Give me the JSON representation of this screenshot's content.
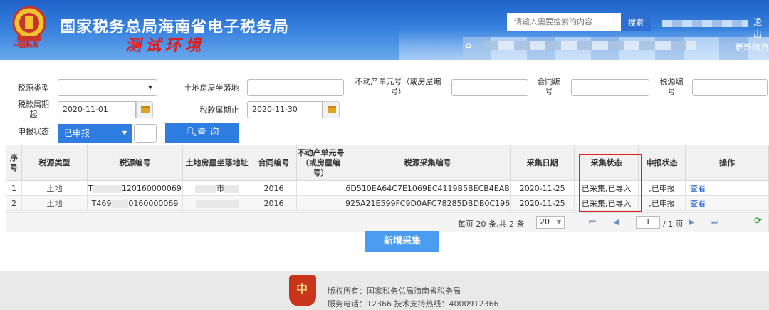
{
  "header": {
    "title": "国家税务总局海南省电子税务局",
    "subtitle": "测试环境",
    "seal_text": "中国税务",
    "search_placeholder": "请输入需要搜索的内容",
    "search_button": "搜索",
    "logout": "退出",
    "update_info": "更新信息",
    "colors": {
      "header_blue": "#1f62c9",
      "accent_red": "#e21b1b"
    }
  },
  "filters": {
    "tax_type_label": "税源类型",
    "tax_type_value": "",
    "location_label": "土地房屋坐落地",
    "location_value": "",
    "unit_no_label": "不动产单元号（或房屋编号）",
    "unit_no_value": "",
    "contract_label": "合同编号",
    "contract_value": "",
    "source_no_label": "税源编号",
    "source_no_value": "",
    "period_start_label": "税款属期起",
    "period_start_value": "2020-11-01",
    "period_end_label": "税款属期止",
    "period_end_value": "2020-11-30",
    "report_status_label": "申报状态",
    "report_status_value": "已申报",
    "query_button": "查 询"
  },
  "table": {
    "headers": [
      "序号",
      "税源类型",
      "税源编号",
      "土地房屋坐落地址",
      "合同编号",
      "不动产单元号（或房屋编号）",
      "税源采集编号",
      "采集日期",
      "采集状态",
      "申报状态",
      "操作"
    ],
    "rows": [
      {
        "seq": "1",
        "type": "土地",
        "source_no": "T",
        "source_no_tail": "120160000069",
        "address": "市",
        "contract": "2016",
        "unit": "",
        "collect_no": "6D510EA64C7E1069EC4119B5BECB4EAB",
        "date": "2020-11-25",
        "collect_status": "已采集,已导入",
        "report_status": ",已申报",
        "action": "查看"
      },
      {
        "seq": "2",
        "type": "土地",
        "source_no": "T469",
        "source_no_tail": "0160000069",
        "address": "",
        "contract": "2016",
        "unit": "",
        "collect_no": "925A21E599FC9D0AFC78285DBDB0C196",
        "date": "2020-11-25",
        "collect_status": "已采集,已导入",
        "report_status": ",已申报",
        "action": "查看"
      }
    ]
  },
  "pager": {
    "summary": "每页 20 条,共 2 条",
    "page_size": "20",
    "current_page": "1",
    "total_pages": "/ 1 页"
  },
  "add_button": "新增采集",
  "footer": {
    "emblem_label": "中",
    "copyright": "版权所有：国家税务总局海南省税务局",
    "phone": "服务电话：12366 技术支持热线：4000912366"
  }
}
